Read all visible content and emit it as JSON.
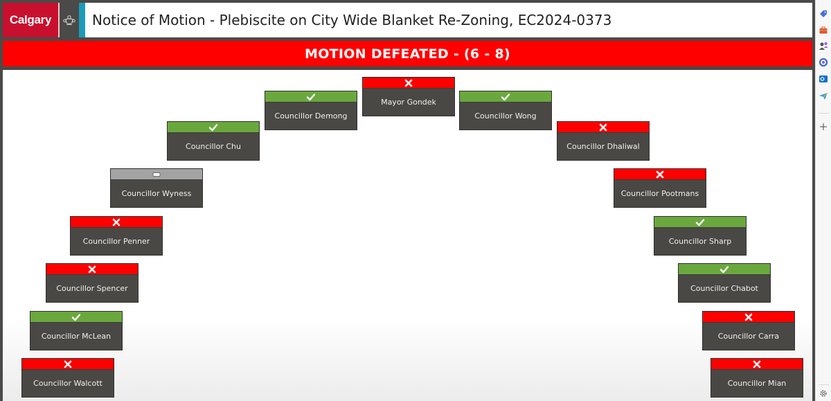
{
  "header": {
    "logo_text": "Calgary",
    "title": "Notice of Motion - Plebiscite on City Wide Blanket Re-Zoning, EC2024-0373"
  },
  "result": {
    "banner": "MOTION DEFEATED - (6 - 8)",
    "outcome": "defeated",
    "for": 6,
    "against": 8
  },
  "colors": {
    "yes": "#6aa83e",
    "no": "#ff0000",
    "absent": "#a3a3a3",
    "brand_red": "#c8102e",
    "accent_teal": "#1c9bb8"
  },
  "members": [
    {
      "name": "Councillor Walcott",
      "vote": "no",
      "icon": "x-icon"
    },
    {
      "name": "Councillor McLean",
      "vote": "yes",
      "icon": "check-icon"
    },
    {
      "name": "Councillor Spencer",
      "vote": "no",
      "icon": "x-icon"
    },
    {
      "name": "Councillor Penner",
      "vote": "no",
      "icon": "x-icon"
    },
    {
      "name": "Councillor Wyness",
      "vote": "absent",
      "icon": "minus-icon"
    },
    {
      "name": "Councillor Chu",
      "vote": "yes",
      "icon": "check-icon"
    },
    {
      "name": "Councillor Demong",
      "vote": "yes",
      "icon": "check-icon"
    },
    {
      "name": "Mayor Gondek",
      "vote": "no",
      "icon": "x-icon"
    },
    {
      "name": "Councillor Wong",
      "vote": "yes",
      "icon": "check-icon"
    },
    {
      "name": "Councillor Dhaliwal",
      "vote": "no",
      "icon": "x-icon"
    },
    {
      "name": "Councillor Pootmans",
      "vote": "no",
      "icon": "x-icon"
    },
    {
      "name": "Councillor Sharp",
      "vote": "yes",
      "icon": "check-icon"
    },
    {
      "name": "Councillor Chabot",
      "vote": "yes",
      "icon": "check-icon"
    },
    {
      "name": "Councillor Carra",
      "vote": "no",
      "icon": "x-icon"
    },
    {
      "name": "Councillor Mian",
      "vote": "no",
      "icon": "x-icon"
    }
  ],
  "browser_sidebar": {
    "icons": [
      "tag-icon",
      "briefcase-icon",
      "people-icon",
      "copilot-icon",
      "outlook-icon",
      "send-icon",
      "add-icon",
      "settings-icon"
    ]
  }
}
